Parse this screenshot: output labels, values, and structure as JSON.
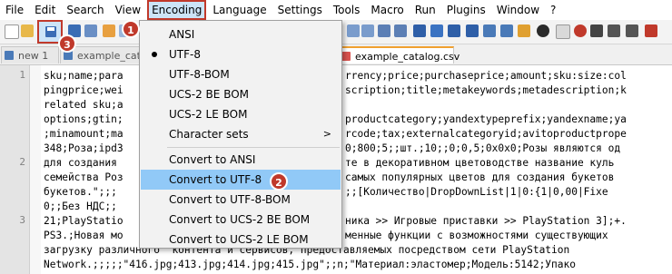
{
  "menubar": {
    "items": [
      "File",
      "Edit",
      "Search",
      "View",
      "Encoding",
      "Language",
      "Settings",
      "Tools",
      "Macro",
      "Run",
      "Plugins",
      "Window",
      "?"
    ]
  },
  "tabs": [
    {
      "label": "new 1",
      "icon_color": "#4a7ab8"
    },
    {
      "label": "example_cata",
      "icon_color": "#4a7ab8"
    },
    {
      "label": "example_catalog.csv",
      "icon_color": "#d9534f"
    }
  ],
  "editor": {
    "line_numbers": [
      "1",
      "2",
      "3"
    ],
    "lines": [
      "sku;name;para",
      "pingprice;wei",
      "related sku;a",
      "options;gtin;",
      ";minamount;ma",
      "348;Роза;ipd3",
      "для создания",
      "семейства Роз",
      "букетов.\";;;",
      "0;;Без НДС;;",
      "21;PlayStatio",
      "PS3.;Новая мо",
      "загрузку различного  контента и сервисов, предоставляемых посредством сети PlayStation",
      "Network.;;;;;\"416.jpg;413.jpg;414.jpg;415.jpg\";;n;\"Материал:эластомер;Модель:5142;Упако"
    ],
    "lines_right": [
      "rrency;price;purchaseprice;amount;sku:size:col",
      "scription;title;metakeywords;metadescription;k",
      "",
      "productcategory;yandextypeprefix;yandexname;ya",
      "rcode;tax;externalcategoryid;avitoproductprope",
      "0;800;5;;шт.;10;;0;0,5;0х0х0;Розы являются од",
      "те в декоративном цветоводстве название куль",
      "самых популярных цветов для создания букетов",
      ";;[Количество|DropDownList|1|0:{1|0,00|Fixe",
      "",
      "ника >> Игровые приставки >> PlayStation 3];+.",
      "менные функции с возможностями существующих"
    ]
  },
  "encoding_menu": {
    "items": [
      {
        "label": "ANSI",
        "checked": false
      },
      {
        "label": "UTF-8",
        "checked": true
      },
      {
        "label": "UTF-8-BOM",
        "checked": false
      },
      {
        "label": "UCS-2 BE BOM",
        "checked": false
      },
      {
        "label": "UCS-2 LE BOM",
        "checked": false
      },
      {
        "label": "Character sets",
        "submenu": true
      },
      {
        "label": "Convert to ANSI"
      },
      {
        "label": "Convert to UTF-8",
        "highlighted": true
      },
      {
        "label": "Convert to UTF-8-BOM"
      },
      {
        "label": "Convert to UCS-2 BE BOM"
      },
      {
        "label": "Convert to UCS-2 LE BOM"
      }
    ],
    "submenu_arrow": ">"
  },
  "badges": [
    "1",
    "2",
    "3"
  ],
  "colors": {
    "annotation_red": "#c0392b",
    "menu_highlight": "#91c9f7",
    "menu_active": "#cce4f7"
  }
}
